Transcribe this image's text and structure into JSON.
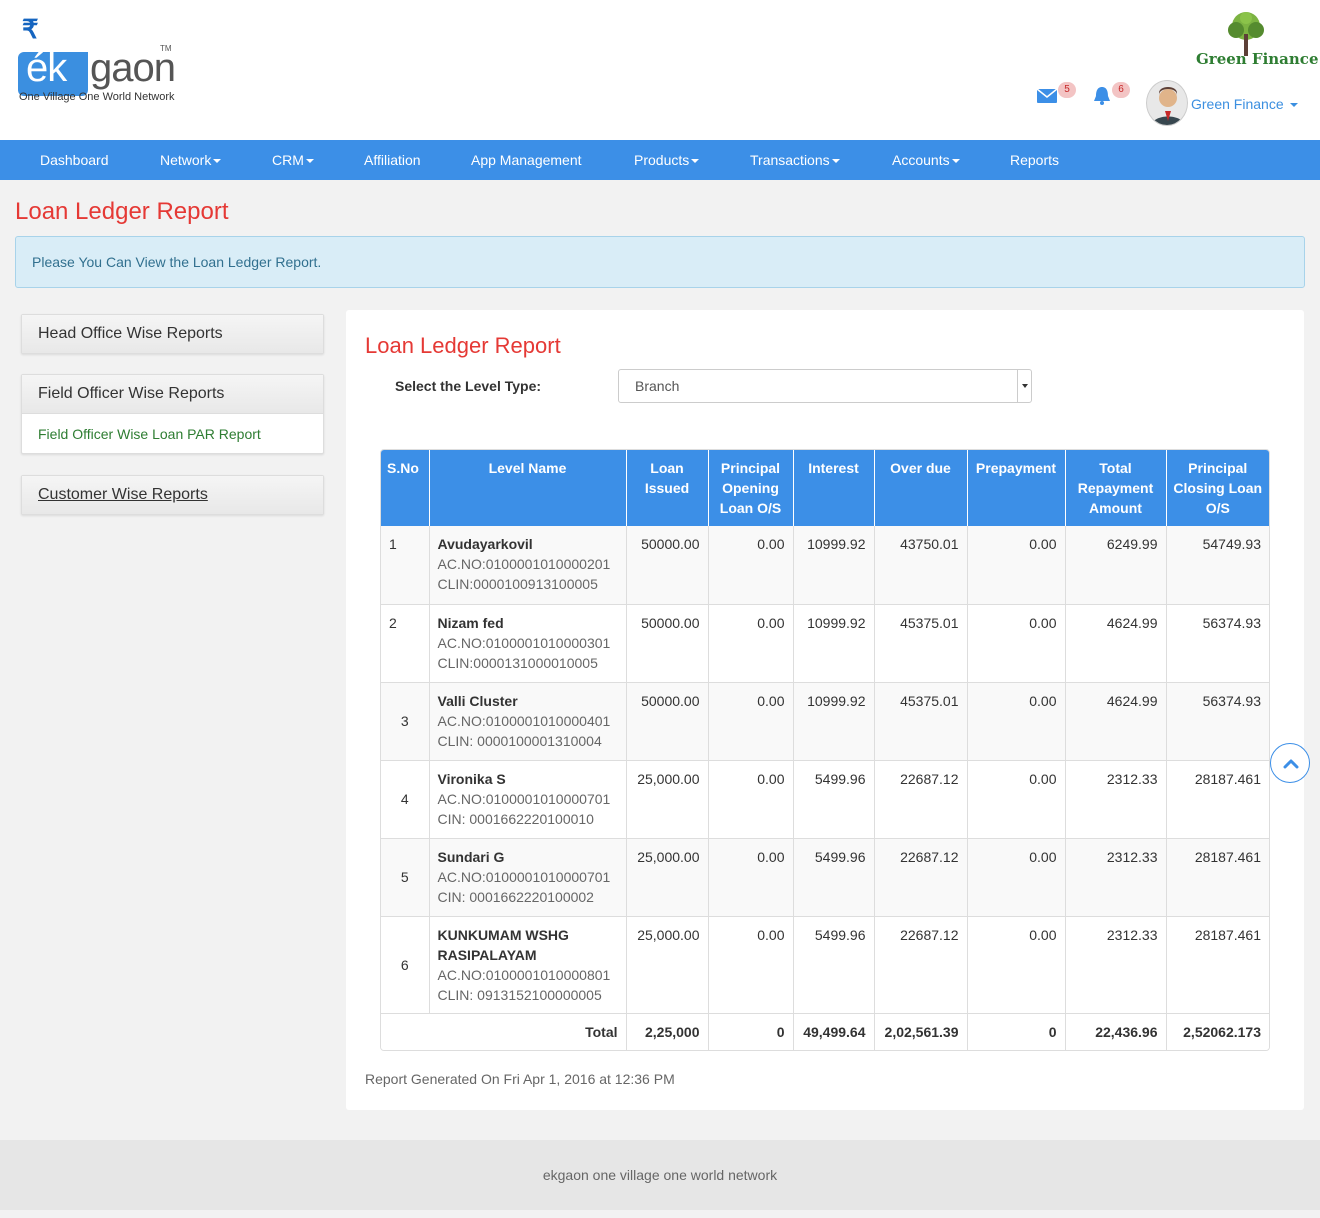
{
  "logo": {
    "rupee": "₹",
    "ek": "ék",
    "gaon": "gaon",
    "tm": "TM",
    "tagline": "One Village One World Network"
  },
  "partner_logo": {
    "text": "Green Finance"
  },
  "header": {
    "mail_count": "5",
    "notification_count": "6",
    "user_name": "Green Finance"
  },
  "nav": {
    "items": [
      {
        "label": "Dashboard"
      },
      {
        "label": "Network"
      },
      {
        "label": "CRM"
      },
      {
        "label": "Affiliation"
      },
      {
        "label": "App Management"
      },
      {
        "label": "Products"
      },
      {
        "label": "Transactions"
      },
      {
        "label": "Accounts"
      },
      {
        "label": "Reports"
      }
    ]
  },
  "page": {
    "title": "Loan Ledger Report",
    "alert": "Please You Can View the Loan Ledger Report."
  },
  "sidebar": {
    "head_office": "Head Office Wise Reports",
    "field_officer": "Field Officer Wise Reports",
    "field_officer_link": "Field Officer Wise Loan PAR Report",
    "customer": "Customer Wise Reports"
  },
  "report": {
    "title": "Loan Ledger Report",
    "level_label": "Select the Level Type:",
    "level_value": "Branch",
    "columns": [
      "S.No",
      "Level Name",
      "Loan Issued",
      "Principal Opening Loan O/S",
      "Interest",
      "Over due",
      "Prepayment",
      "Total Repayment Amount",
      "Principal Closing Loan O/S"
    ],
    "rows": [
      {
        "sno": "1",
        "name": "Avudayarkovil",
        "line1": "AC.NO:0100001010000201",
        "line2": "CLIN:0000100913100005",
        "loan": "50000.00",
        "opening": "0.00",
        "interest": "10999.92",
        "overdue": "43750.01",
        "prepay": "0.00",
        "repay": "6249.99",
        "closing": "54749.93"
      },
      {
        "sno": "2",
        "name": "Nizam fed",
        "line1": "AC.NO:0100001010000301",
        "line2": "CLIN:0000131000010005",
        "loan": "50000.00",
        "opening": "0.00",
        "interest": "10999.92",
        "overdue": "45375.01",
        "prepay": "0.00",
        "repay": "4624.99",
        "closing": "56374.93"
      },
      {
        "sno": "3",
        "name": "Valli Cluster",
        "line1": "AC.NO:0100001010000401",
        "line2": "CLIN: 0000100001310004",
        "loan": "50000.00",
        "opening": "0.00",
        "interest": "10999.92",
        "overdue": "45375.01",
        "prepay": "0.00",
        "repay": "4624.99",
        "closing": "56374.93"
      },
      {
        "sno": "4",
        "name": "Vironika S",
        "line1": "AC.NO:0100001010000701",
        "line2": "CIN: 0001662220100010",
        "loan": "25,000.00",
        "opening": "0.00",
        "interest": "5499.96",
        "overdue": "22687.12",
        "prepay": "0.00",
        "repay": "2312.33",
        "closing": "28187.461"
      },
      {
        "sno": "5",
        "name": "Sundari G",
        "line1": "AC.NO:0100001010000701",
        "line2": "CIN: 0001662220100002",
        "loan": "25,000.00",
        "opening": "0.00",
        "interest": "5499.96",
        "overdue": "22687.12",
        "prepay": "0.00",
        "repay": "2312.33",
        "closing": "28187.461"
      },
      {
        "sno": "6",
        "name": "KUNKUMAM WSHG RASIPALAYAM",
        "line1": "AC.NO:0100001010000801",
        "line2": "CLIN: 0913152100000005",
        "loan": "25,000.00",
        "opening": "0.00",
        "interest": "5499.96",
        "overdue": "22687.12",
        "prepay": "0.00",
        "repay": "2312.33",
        "closing": "28187.461"
      }
    ],
    "total": {
      "label": "Total",
      "loan": "2,25,000",
      "opening": "0",
      "interest": "49,499.64",
      "overdue": "2,02,561.39",
      "prepay": "0",
      "repay": "22,436.96",
      "closing": "2,52062.173"
    },
    "generated": "Report Generated On Fri Apr 1, 2016 at 12:36 PM"
  },
  "footer": {
    "text": "ekgaon one village one world network"
  },
  "colors": {
    "nav": "#3c8fe7",
    "title_red": "#e53935",
    "link_green": "#2e7d32",
    "alert_bg": "#d9edf7"
  },
  "icons": [
    "mail-icon",
    "bell-icon",
    "user-avatar-icon",
    "tree-logo-icon",
    "scroll-up-icon"
  ]
}
